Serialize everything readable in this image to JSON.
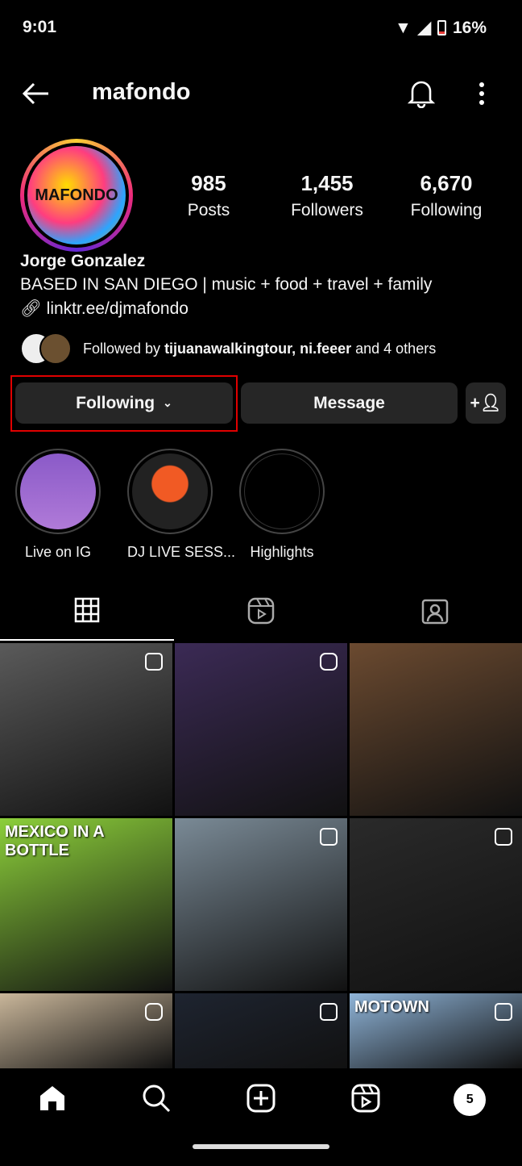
{
  "status_bar": {
    "time": "9:01",
    "battery": "16%"
  },
  "header": {
    "username": "mafondo"
  },
  "profile": {
    "avatar_text": "MAFONDO",
    "stats": [
      {
        "value": "985",
        "label": "Posts"
      },
      {
        "value": "1,455",
        "label": "Followers"
      },
      {
        "value": "6,670",
        "label": "Following"
      }
    ],
    "name": "Jorge Gonzalez",
    "bio": "BASED IN SAN DIEGO | music + food + travel + family",
    "link": "linktr.ee/djmafondo",
    "followed_by_prefix": "Followed by ",
    "followed_by_users": "tijuanawalkingtour, ni.feeer",
    "followed_by_suffix": " and 4 others"
  },
  "buttons": {
    "following": "Following",
    "message": "Message"
  },
  "highlights": [
    {
      "label": "Live on IG"
    },
    {
      "label": "DJ LIVE SESS..."
    },
    {
      "label": "Highlights"
    }
  ],
  "grid": {
    "posts": [
      {
        "bg": "#5a5a5a",
        "badge": "carousel"
      },
      {
        "bg": "#3b2a55",
        "badge": "reel"
      },
      {
        "bg": "#6b4a30",
        "badge": "none"
      },
      {
        "bg": "#8ccf3a",
        "badge": "none",
        "text": "MEXICO IN A BOTTLE"
      },
      {
        "bg": "#7a8a96",
        "badge": "carousel"
      },
      {
        "bg": "#2a2a2a",
        "badge": "carousel"
      },
      {
        "bg": "#c9b69a",
        "badge": "reel"
      },
      {
        "bg": "#1e2430",
        "badge": "carousel"
      },
      {
        "bg": "#8fb4d8",
        "badge": "carousel",
        "text": "MOTOWN"
      }
    ]
  },
  "accent": {
    "highlight_box": "#e00000"
  }
}
